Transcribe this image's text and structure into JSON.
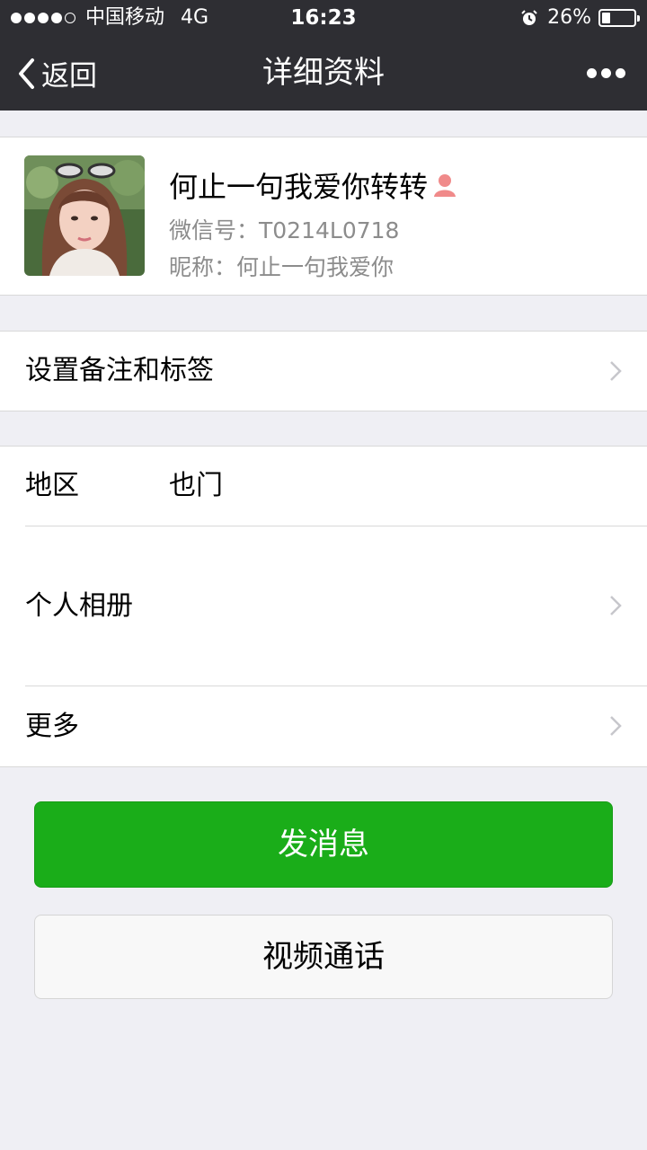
{
  "status_bar": {
    "carrier": "中国移动",
    "network": "4G",
    "time": "16:23",
    "battery": "26%",
    "battery_level": 0.26
  },
  "nav": {
    "back_label": "返回",
    "title": "详细资料"
  },
  "profile": {
    "name": "何止一句我爱你转转",
    "wechat_id": "微信号：T0214L0718",
    "nickname": "昵称：何止一句我爱你",
    "gender_icon": "female-icon"
  },
  "rows": {
    "remark_tags": "设置备注和标签",
    "region_label": "地区",
    "region_value": "也门",
    "album": "个人相册",
    "more": "更多"
  },
  "buttons": {
    "send_message": "发消息",
    "video_call": "视频通话"
  },
  "colors": {
    "nav_bg": "#2e2e33",
    "accent_green": "#1aad19",
    "page_bg": "#efeff4"
  }
}
